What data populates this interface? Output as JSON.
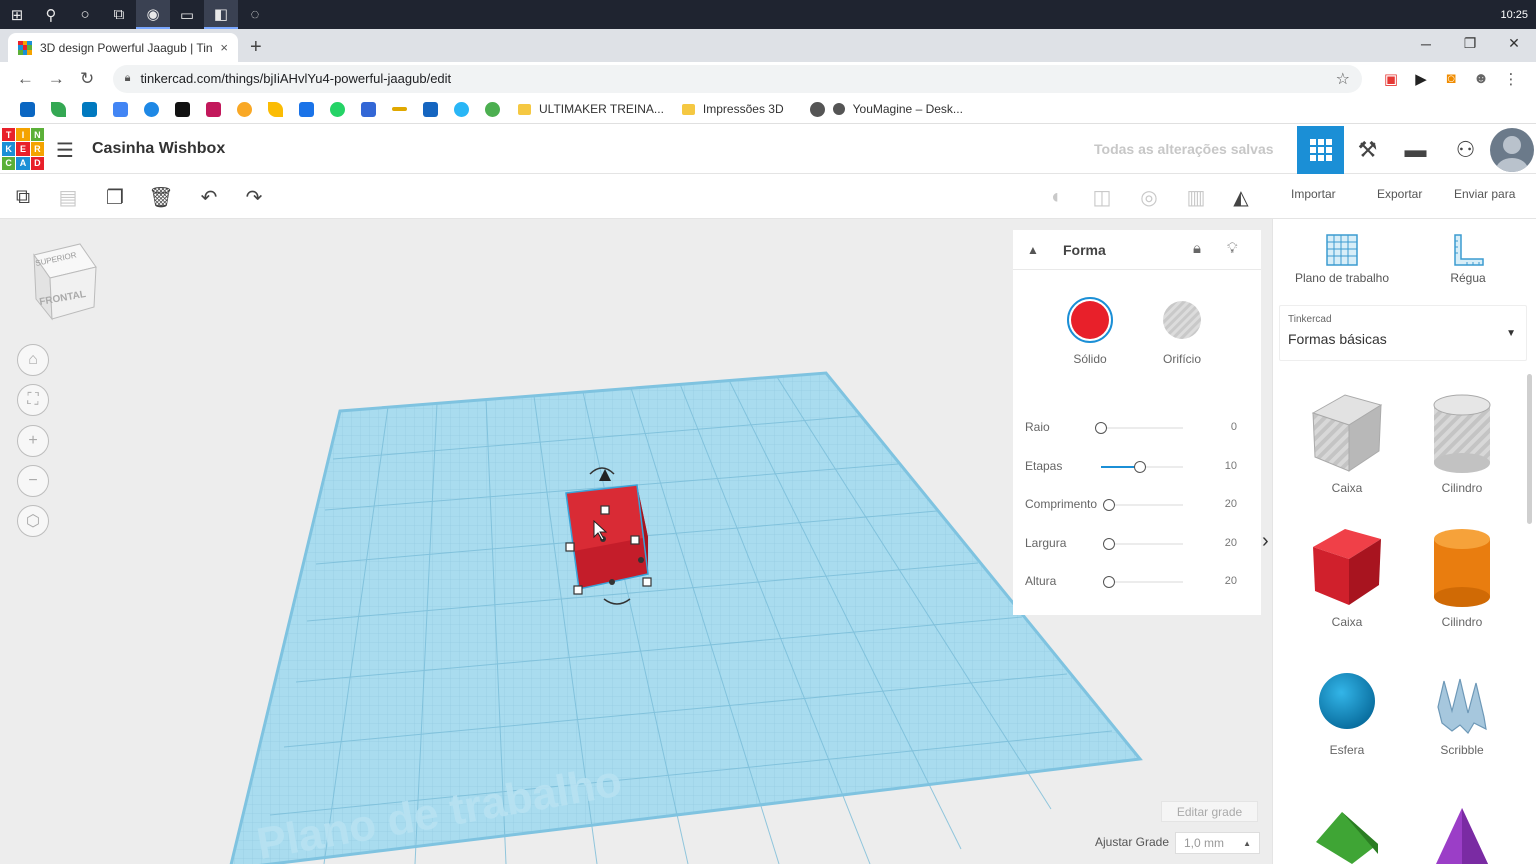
{
  "taskbar": {
    "clock": "10:25"
  },
  "browser": {
    "tab_title": "3D design Powerful Jaagub | Tinkercad",
    "tab_close": "×",
    "new_tab": "+",
    "url": "tinkercad.com/things/bjIiAHvlYu4-powerful-jaagub/edit"
  },
  "bookmarks": {
    "folders": [
      "ULTIMAKER TREINA...",
      "Impressões 3D"
    ],
    "youmagine": "YouMagine – Desk..."
  },
  "header": {
    "design_title": "Casinha Wishbox",
    "saved_status": "Todas as alterações salvas",
    "logo_letters": [
      "T",
      "I",
      "N",
      "K",
      "E",
      "R",
      "C",
      "A",
      "D"
    ]
  },
  "toolbar": {
    "import_label": "Importar",
    "export_label": "Exportar",
    "send_label": "Enviar para"
  },
  "viewcube": {
    "top_label": "SUPERIOR",
    "front_label": "FRONTAL"
  },
  "workplane": {
    "watermark": "Plano de trabalho"
  },
  "inspector": {
    "title": "Forma",
    "solid_label": "Sólido",
    "hole_label": "Orifício",
    "solid_color": "#e8202a",
    "params": [
      {
        "name": "Raio",
        "value": "0",
        "fraction": 0.0
      },
      {
        "name": "Etapas",
        "value": "10",
        "fraction": 0.47
      },
      {
        "name": "Comprimento",
        "value": "20",
        "fraction": 0.0
      },
      {
        "name": "Largura",
        "value": "20",
        "fraction": 0.0
      },
      {
        "name": "Altura",
        "value": "20",
        "fraction": 0.0
      }
    ]
  },
  "grid": {
    "edit_grid_label": "Editar grade",
    "snap_label": "Ajustar Grade",
    "snap_value": "1,0 mm"
  },
  "rightpanel": {
    "workplane_label": "Plano de trabalho",
    "ruler_label": "Régua",
    "library_category": "Tinkercad",
    "library_name": "Formas básicas",
    "shapes": [
      "Caixa",
      "Cilindro",
      "Caixa",
      "Cilindro",
      "Esfera",
      "Scribble"
    ]
  },
  "colors": {
    "accent": "#1b8fd6",
    "grid_blue": "#9fd3ea",
    "shape_red": "#d0202c"
  }
}
